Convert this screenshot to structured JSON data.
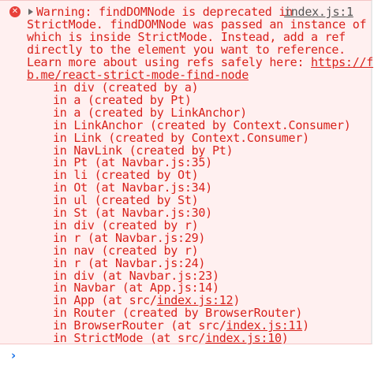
{
  "console": {
    "message_lines": [
      "Warning: findDOMNode is deprecated in",
      "StrictMode. findDOMNode was passed an instance of a",
      "which is inside StrictMode. Instead, add a ref",
      "directly to the element you want to reference.",
      "Learn more about using refs safely here: "
    ],
    "source_link": "index.js:1",
    "docs_link_part1": "https://f",
    "docs_link_part2": "b.me/react-strict-mode-find-node",
    "trace": [
      {
        "text": "in div (created by a)"
      },
      {
        "text": "in a (created by Pt)"
      },
      {
        "text": "in a (created by LinkAnchor)"
      },
      {
        "text": "in LinkAnchor (created by Context.Consumer)"
      },
      {
        "text": "in Link (created by Context.Consumer)"
      },
      {
        "text": "in NavLink (created by Pt)"
      },
      {
        "text": "in Pt (at Navbar.js:35)"
      },
      {
        "text": "in li (created by Ot)"
      },
      {
        "text": "in Ot (at Navbar.js:34)"
      },
      {
        "text": "in ul (created by St)"
      },
      {
        "text": "in St (at Navbar.js:30)"
      },
      {
        "text": "in div (created by r)"
      },
      {
        "text": "in r (at Navbar.js:29)"
      },
      {
        "text": "in nav (created by r)"
      },
      {
        "text": "in r (at Navbar.js:24)"
      },
      {
        "text": "in div (at Navbar.js:23)"
      },
      {
        "text": "in Navbar (at App.js:14)"
      },
      {
        "text": "in App (at src/",
        "link": "index.js:12",
        "after": ")"
      },
      {
        "text": "in Router (created by BrowserRouter)"
      },
      {
        "text": "in BrowserRouter (at src/",
        "link": "index.js:11",
        "after": ")"
      },
      {
        "text": "in StrictMode (at src/",
        "link": "index.js:10",
        "after": ")"
      }
    ]
  },
  "icons": {
    "error": "error-circle-x-icon",
    "disclosure": "disclosure-triangle-icon",
    "prompt": "prompt-chevron-icon"
  },
  "colors": {
    "error_text": "#d9221c",
    "error_background": "#fff0f0",
    "error_icon": "#e8413a",
    "prompt_chevron": "#1a73e8"
  }
}
